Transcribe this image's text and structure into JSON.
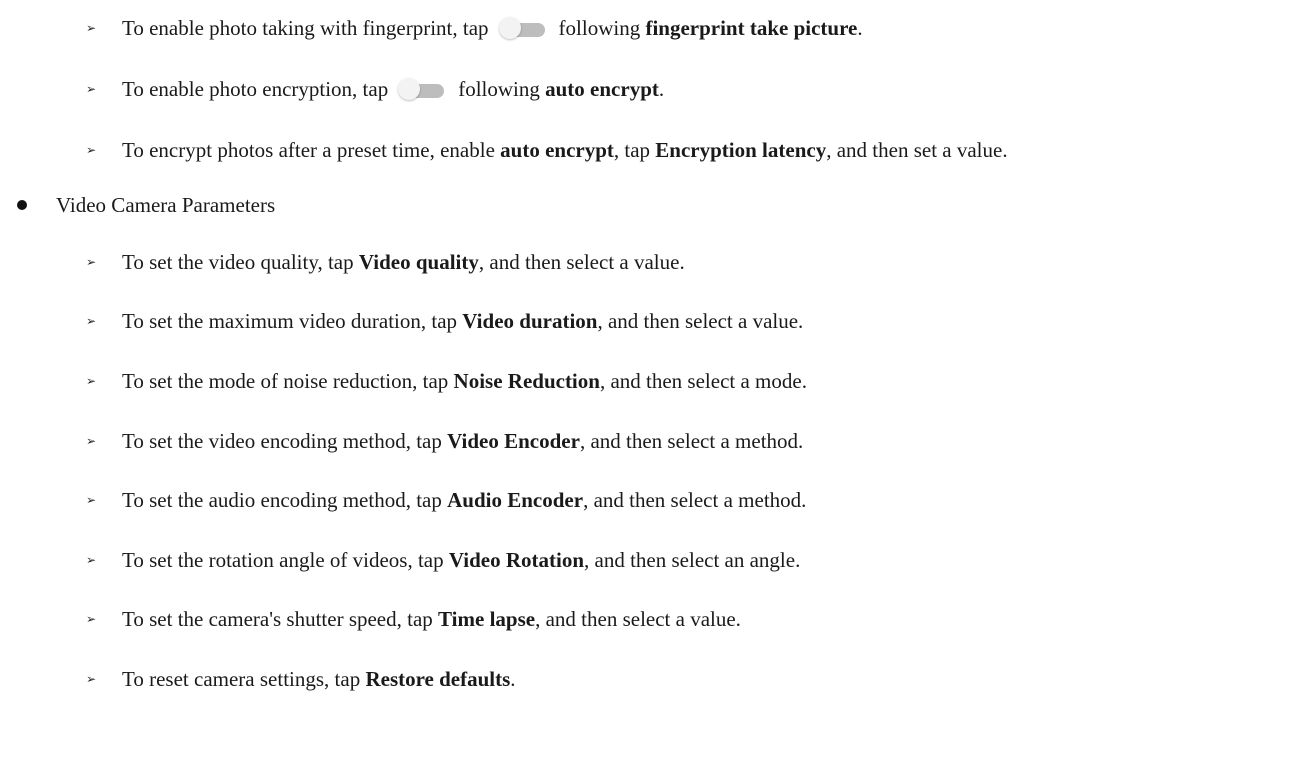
{
  "markers": {
    "sub": "➢"
  },
  "items": [
    {
      "pre": "To enable photo taking with fingerprint, tap",
      "mid": "following",
      "bold": "fingerprint take picture",
      "post": ".",
      "toggle_icon": "toggle-switch-off-icon"
    },
    {
      "pre": "To enable photo encryption, tap",
      "mid": "following",
      "bold": "auto encrypt",
      "post": ".",
      "toggle_icon": "toggle-switch-off-icon"
    },
    {
      "a": "To encrypt photos after a preset time, enable ",
      "b1": "auto encrypt",
      "c": ", tap ",
      "b2": "Encryption latency",
      "d": ", and then set a value."
    }
  ],
  "section": {
    "title": "Video Camera Parameters"
  },
  "video_items": [
    {
      "pre": "To set the video quality, tap ",
      "bold": "Video quality",
      "post": ", and then select a value."
    },
    {
      "pre": "To set the maximum video duration, tap ",
      "bold": "Video duration",
      "post": ", and then select a value."
    },
    {
      "pre": "To set the mode of noise reduction, tap ",
      "bold": "Noise Reduction",
      "post": ", and then select a mode."
    },
    {
      "pre": "To set the video encoding method, tap ",
      "bold": "Video Encoder",
      "post": ", and then select a method."
    },
    {
      "pre": "To set the audio encoding method, tap ",
      "bold": "Audio Encoder",
      "post": ", and then select a method."
    },
    {
      "pre": "To set the rotation angle of videos, tap ",
      "bold": "Video Rotation",
      "post": ", and then select an angle."
    },
    {
      "pre": "To set the camera's shutter speed, tap ",
      "bold": "Time lapse",
      "post": ", and then select a value."
    },
    {
      "pre": "To reset camera settings, tap ",
      "bold": "Restore defaults",
      "post": "."
    }
  ]
}
